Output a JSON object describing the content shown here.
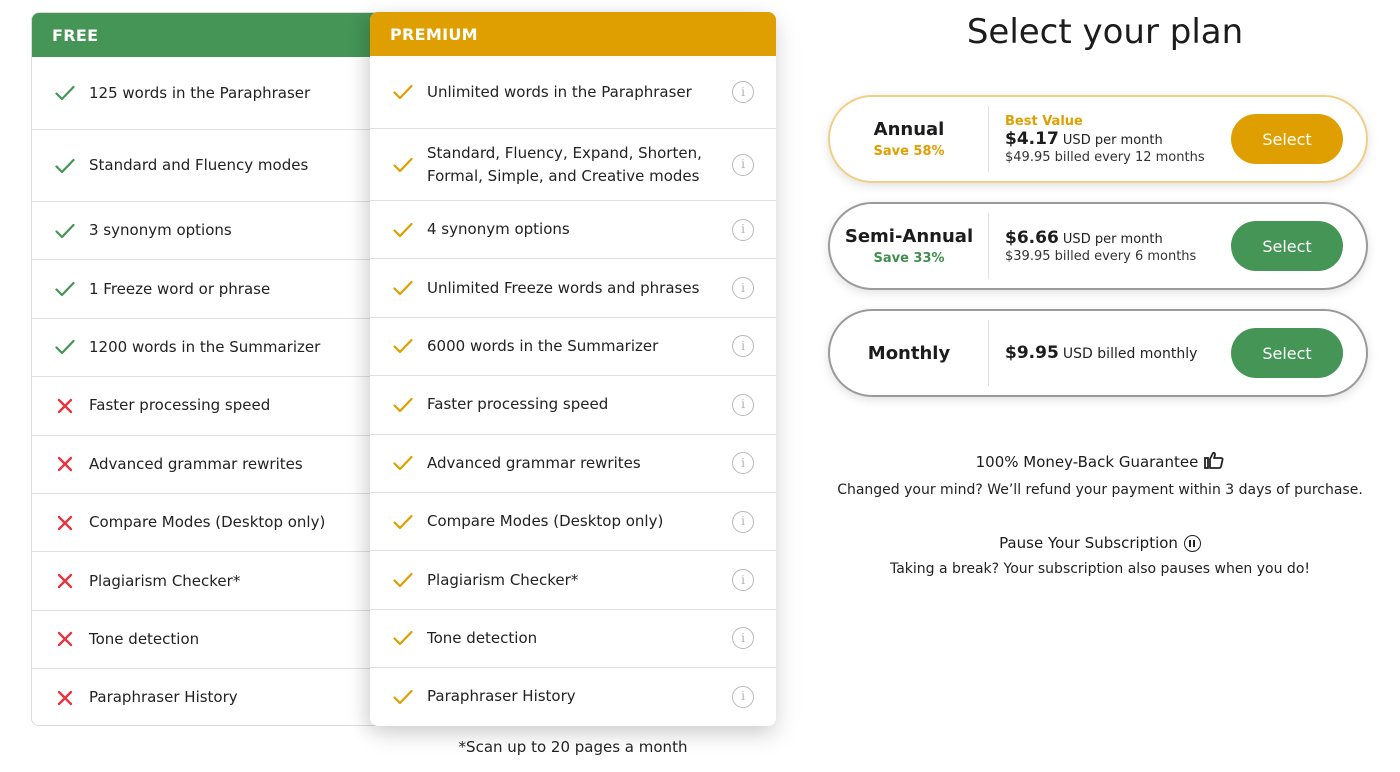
{
  "colors": {
    "free_accent": "#459556",
    "premium_accent": "#e09f00",
    "cross": "#e8333d",
    "info_icon": "#b8b8b8"
  },
  "comparison": {
    "free_header": "FREE",
    "premium_header": "PREMIUM",
    "rows": [
      {
        "free": {
          "status": "check",
          "text": "125 words in the Paraphraser"
        },
        "premium": {
          "status": "check",
          "text": "Unlimited words in the Paraphraser"
        }
      },
      {
        "free": {
          "status": "check",
          "text": "Standard and Fluency modes"
        },
        "premium": {
          "status": "check",
          "text": "Standard, Fluency, Expand, Shorten, Formal, Simple, and Creative modes"
        }
      },
      {
        "free": {
          "status": "check",
          "text": "3 synonym options"
        },
        "premium": {
          "status": "check",
          "text": "4 synonym options"
        }
      },
      {
        "free": {
          "status": "check",
          "text": "1 Freeze word or phrase"
        },
        "premium": {
          "status": "check",
          "text": "Unlimited Freeze words and phrases"
        }
      },
      {
        "free": {
          "status": "check",
          "text": "1200 words in the Summarizer"
        },
        "premium": {
          "status": "check",
          "text": "6000 words in the Summarizer"
        }
      },
      {
        "free": {
          "status": "cross",
          "text": "Faster processing speed"
        },
        "premium": {
          "status": "check",
          "text": "Faster processing speed"
        }
      },
      {
        "free": {
          "status": "cross",
          "text": "Advanced grammar rewrites"
        },
        "premium": {
          "status": "check",
          "text": "Advanced grammar rewrites"
        }
      },
      {
        "free": {
          "status": "cross",
          "text": "Compare Modes (Desktop only)"
        },
        "premium": {
          "status": "check",
          "text": "Compare Modes (Desktop only)"
        }
      },
      {
        "free": {
          "status": "cross",
          "text": "Plagiarism Checker*"
        },
        "premium": {
          "status": "check",
          "text": "Plagiarism Checker*"
        }
      },
      {
        "free": {
          "status": "cross",
          "text": "Tone detection"
        },
        "premium": {
          "status": "check",
          "text": "Tone detection"
        }
      },
      {
        "free": {
          "status": "cross",
          "text": "Paraphraser History"
        },
        "premium": {
          "status": "check",
          "text": "Paraphraser History"
        }
      }
    ],
    "footnote": "*Scan up to 20 pages a month"
  },
  "plans": {
    "title": "Select your plan",
    "items": [
      {
        "name": "Annual",
        "save": "Save 58%",
        "badge": "Best Value",
        "price": "$4.17",
        "price_suffix": "USD per month",
        "billed": "$49.95 billed every 12 months",
        "button": "Select"
      },
      {
        "name": "Semi-Annual",
        "save": "Save 33%",
        "badge": "",
        "price": "$6.66",
        "price_suffix": "USD per month",
        "billed": "$39.95 billed every 6 months",
        "button": "Select"
      },
      {
        "name": "Monthly",
        "save": "",
        "badge": "",
        "price": "$9.95",
        "price_suffix": "USD billed monthly",
        "billed": "",
        "button": "Select"
      }
    ]
  },
  "guarantee": {
    "heading": "100% Money-Back Guarantee",
    "icon": "thumbs-up-icon",
    "text": "Changed your mind? We’ll refund your payment within 3 days of purchase."
  },
  "pause": {
    "heading": "Pause Your Subscription",
    "icon": "pause-circle-icon",
    "text": "Taking a break? Your subscription also pauses when you do!"
  }
}
